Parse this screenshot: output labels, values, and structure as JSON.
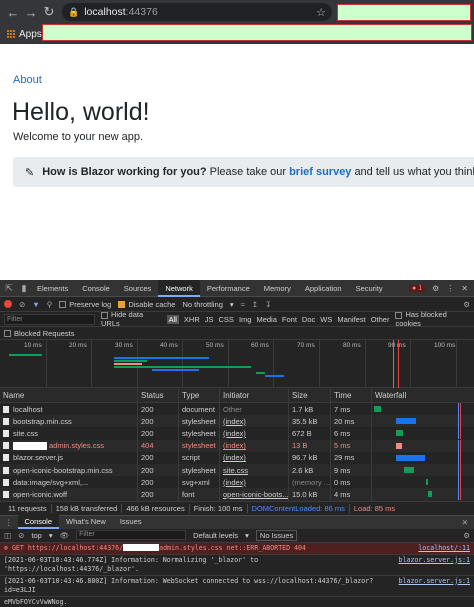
{
  "browser": {
    "url_host": "localhost",
    "url_port": ":44376",
    "bookmarks_apps": "Apps"
  },
  "page": {
    "nav_about": "About",
    "heading": "Hello, world!",
    "welcome": "Welcome to your new app.",
    "survey_question": "How is Blazor working for you?",
    "survey_pre": "Please take our",
    "survey_link": "brief survey",
    "survey_post": "and tell us what you think."
  },
  "devtools": {
    "tabs": [
      "Elements",
      "Console",
      "Sources",
      "Network",
      "Performance",
      "Memory",
      "Application",
      "Security"
    ],
    "active_tab": "Network",
    "error_count": "1",
    "preserve_log": "Preserve log",
    "disable_cache": "Disable cache",
    "throttling": "No throttling",
    "filter_placeholder": "Filter",
    "hide_data_urls": "Hide data URLs",
    "filter_types": [
      "All",
      "XHR",
      "JS",
      "CSS",
      "Img",
      "Media",
      "Font",
      "Doc",
      "WS",
      "Manifest",
      "Other"
    ],
    "has_blocked_cookies": "Has blocked cookies",
    "blocked_requests": "Blocked Requests",
    "overview_ticks": [
      "10 ms",
      "20 ms",
      "30 ms",
      "40 ms",
      "50 ms",
      "60 ms",
      "70 ms",
      "80 ms",
      "90 ms",
      "100 ms"
    ],
    "columns": {
      "name": "Name",
      "status": "Status",
      "type": "Type",
      "initiator": "Initiator",
      "size": "Size",
      "time": "Time",
      "waterfall": "Waterfall"
    },
    "rows": [
      {
        "name": "localhost",
        "status": "200",
        "type": "document",
        "initiator": "Other",
        "size": "1.7 kB",
        "time": "7 ms",
        "wf_start": 0.02,
        "wf_end": 0.09
      },
      {
        "name": "bootstrap.min.css",
        "status": "200",
        "type": "stylesheet",
        "initiator": "(index)",
        "size": "35.5 kB",
        "time": "20 ms",
        "wf_start": 0.24,
        "wf_end": 0.44
      },
      {
        "name": "site.css",
        "status": "200",
        "type": "stylesheet",
        "initiator": "(index)",
        "size": "672 B",
        "time": "6 ms",
        "wf_start": 0.24,
        "wf_end": 0.31
      },
      {
        "name": "admin.styles.css",
        "status": "404",
        "type": "stylesheet",
        "initiator": "(index)",
        "size": "13 B",
        "time": "5 ms",
        "wf_start": 0.24,
        "wf_end": 0.3,
        "error": true
      },
      {
        "name": "blazor.server.js",
        "status": "200",
        "type": "script",
        "initiator": "(index)",
        "size": "96.7 kB",
        "time": "29 ms",
        "wf_start": 0.24,
        "wf_end": 0.53
      },
      {
        "name": "open-iconic-bootstrap.min.css",
        "status": "200",
        "type": "stylesheet",
        "initiator": "site.css",
        "size": "2.6 kB",
        "time": "9 ms",
        "wf_start": 0.32,
        "wf_end": 0.42
      },
      {
        "name": "data:image/svg+xml,...",
        "status": "200",
        "type": "svg+xml",
        "initiator": "(index)",
        "size": "(memory ...",
        "time": "0 ms",
        "wf_start": 0.54,
        "wf_end": 0.56
      },
      {
        "name": "open-iconic.woff",
        "status": "200",
        "type": "font",
        "initiator": "open-iconic-boots...",
        "size": "15.0 kB",
        "time": "4 ms",
        "wf_start": 0.56,
        "wf_end": 0.6
      }
    ],
    "summary": {
      "requests": "11 requests",
      "transferred": "158 kB transferred",
      "resources": "466 kB resources",
      "finish": "Finish: 100 ms",
      "dcl": "DOMContentLoaded: 86 ms",
      "load": "Load: 85 ms"
    }
  },
  "console": {
    "tabs": [
      "Console",
      "What's New",
      "Issues"
    ],
    "context": "top",
    "filter_placeholder": "Filter",
    "default_levels": "Default levels",
    "no_issues": "No Issues",
    "logs": [
      {
        "level": "error",
        "pre": "GET https://localhost:44376/",
        "post": "admin.styles.css net::ERR_ABORTED 404",
        "src": "localhost/:11"
      },
      {
        "level": "info",
        "text": "[2021-06-03T10:43:46.774Z] Information: Normalizing '_blazor' to 'https://localhost:44376/_blazor'.",
        "src": "blazor.server.js:1"
      },
      {
        "level": "info",
        "text": "[2021-06-03T10:43:46.880Z] Information: WebSocket connected to wss://localhost:44376/_blazor?id=e3LJI",
        "src": "blazor.server.js:1"
      },
      {
        "level": "info",
        "text": "eMVbFOYCvVwWNog.",
        "src": ""
      }
    ]
  },
  "colors": {
    "link": "#1b6ec2",
    "error": "#f28b82",
    "dcl": "#4a8cff",
    "redaction": "#ccffcc"
  }
}
